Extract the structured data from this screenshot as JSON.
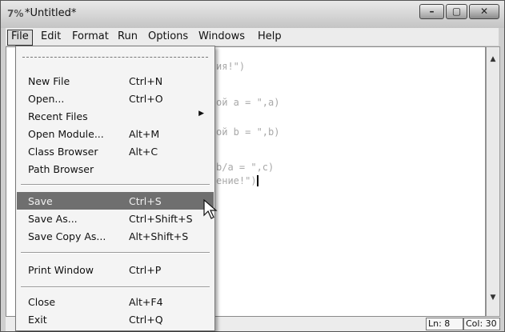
{
  "window": {
    "title": "*Untitled*",
    "app_icon": "7%"
  },
  "menubar": [
    "File",
    "Edit",
    "Format",
    "Run",
    "Options",
    "Windows",
    "Help"
  ],
  "file_menu": {
    "items": [
      {
        "label": "New File",
        "accel": "Ctrl+N"
      },
      {
        "label": "Open...",
        "accel": "Ctrl+O"
      },
      {
        "label": "Recent Files",
        "accel": ""
      },
      {
        "label": "Open Module...",
        "accel": "Alt+M"
      },
      {
        "label": "Class Browser",
        "accel": "Alt+C"
      },
      {
        "label": "Path Browser",
        "accel": ""
      },
      {
        "label": "Save",
        "accel": "Ctrl+S"
      },
      {
        "label": "Save As...",
        "accel": "Ctrl+Shift+S"
      },
      {
        "label": "Save Copy As...",
        "accel": "Alt+Shift+S"
      },
      {
        "label": "Print Window",
        "accel": "Ctrl+P"
      },
      {
        "label": "Close",
        "accel": "Alt+F4"
      },
      {
        "label": "Exit",
        "accel": "Ctrl+Q"
      }
    ],
    "selected": "Save"
  },
  "editor": {
    "visible_fragments": [
      "ия!\")",
      "ой a = \",a)",
      "ой b = \",b)",
      "b/a = \",c)",
      "ение!\")"
    ]
  },
  "status": {
    "line": "Ln: 8",
    "col": "Col: 30"
  }
}
